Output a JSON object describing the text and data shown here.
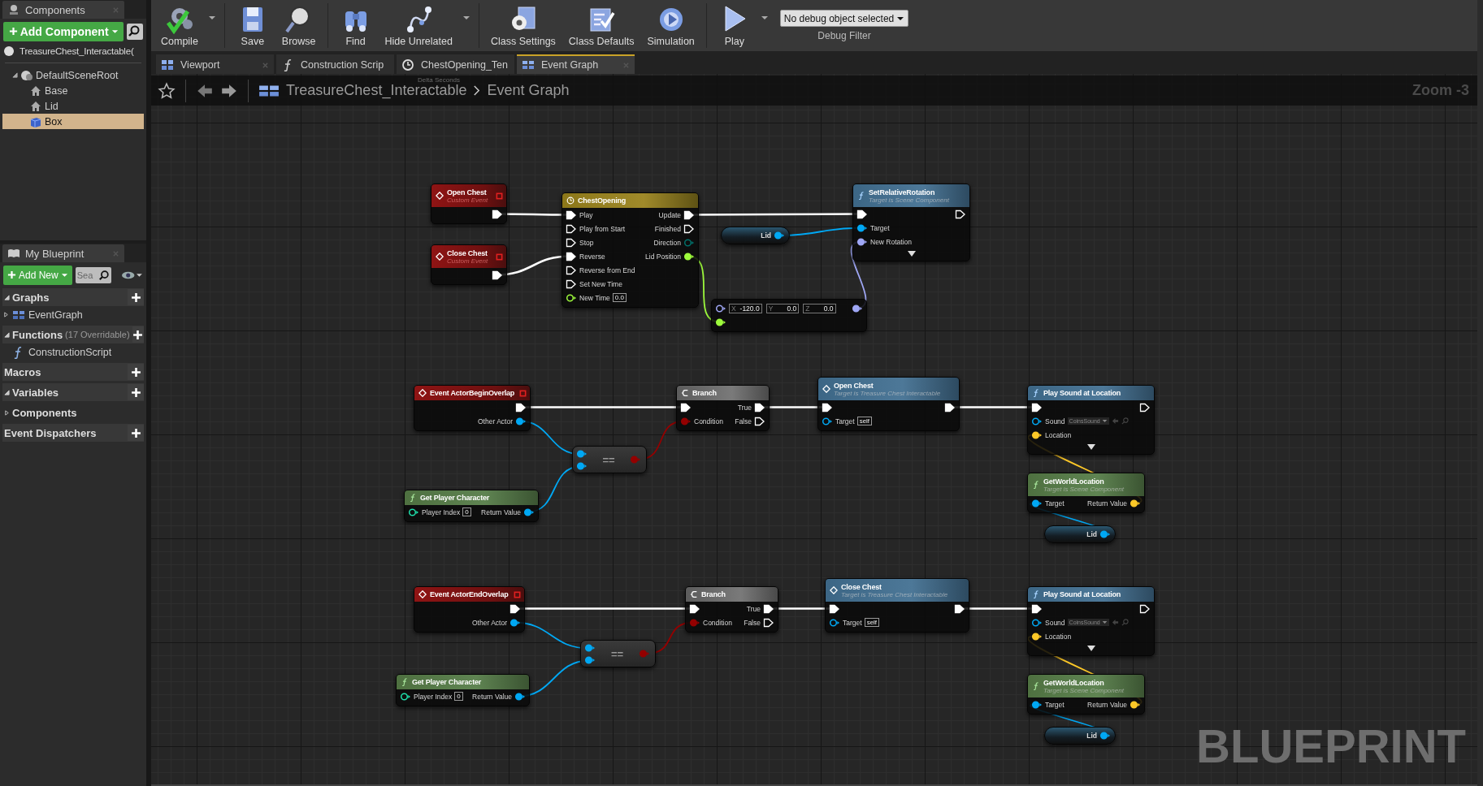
{
  "components": {
    "tab": "Components",
    "add_button": "Add Component",
    "self": "TreasureChest_Interactable(",
    "tree": [
      {
        "label": "DefaultSceneRoot",
        "kind": "scene_root",
        "expanded": true,
        "selected": false,
        "children": [
          {
            "label": "Base",
            "kind": "mesh",
            "selected": false
          },
          {
            "label": "Lid",
            "kind": "mesh",
            "selected": false
          },
          {
            "label": "Box",
            "kind": "box",
            "selected": true
          }
        ]
      }
    ]
  },
  "my_blueprint": {
    "tab": "My Blueprint",
    "add_button": "Add New",
    "search": {
      "placeholder": "Sea"
    },
    "sections": [
      {
        "label": "Graphs",
        "expanded": true,
        "addable": true,
        "items": [
          {
            "label": "EventGraph",
            "kind": "graph",
            "expanded": false
          }
        ]
      },
      {
        "label": "Functions",
        "note": "(17 Overridable)",
        "expanded": true,
        "addable": true,
        "items": [
          {
            "label": "ConstructionScript",
            "kind": "function"
          }
        ]
      },
      {
        "label": "Macros",
        "addable": true
      },
      {
        "label": "Variables",
        "expanded": true,
        "addable": true
      },
      {
        "label": "Components",
        "expanded": false,
        "addable": false
      },
      {
        "label": "Event Dispatchers",
        "addable": true
      }
    ]
  },
  "toolbar": {
    "groups": [
      [
        {
          "label": "Compile",
          "kind": "compile",
          "dropdown": true
        }
      ],
      [
        {
          "label": "Save",
          "kind": "save"
        },
        {
          "label": "Browse",
          "kind": "browse"
        }
      ],
      [
        {
          "label": "Find",
          "kind": "find"
        },
        {
          "label": "Hide Unrelated",
          "kind": "hide",
          "dropdown": true
        }
      ],
      [
        {
          "label": "Class Settings",
          "kind": "class_settings"
        },
        {
          "label": "Class Defaults",
          "kind": "class_defaults"
        },
        {
          "label": "Simulation",
          "kind": "simulation"
        }
      ],
      [
        {
          "label": "Play",
          "kind": "play",
          "dropdown": true
        }
      ]
    ],
    "debug": {
      "value": "No debug object selected",
      "label": "Debug Filter"
    }
  },
  "tabs": [
    {
      "label": "Viewport",
      "kind": "viewport",
      "selected": false
    },
    {
      "label": "Construction Scrip",
      "kind": "function",
      "selected": false
    },
    {
      "label": "ChestOpening_Ten",
      "kind": "timeline",
      "selected": false
    },
    {
      "label": "Event Graph",
      "kind": "graph",
      "selected": true
    }
  ],
  "breadcrumb": {
    "path": [
      "TreasureChest_Interactable",
      "Event Graph"
    ],
    "ghost_pin": "Delta Seconds"
  },
  "graph": {
    "zoom": "Zoom -3",
    "watermark": "BLUEPRINT",
    "nodes": [
      {
        "kind": "event",
        "title": "Open Chest",
        "subtitle": "Custom Event",
        "rows": [
          {
            "right": {
              "kind": "exec",
              "linked": true
            }
          }
        ]
      },
      {
        "kind": "event",
        "title": "Close Chest",
        "subtitle": "Custom Event",
        "rows": [
          {
            "right": {
              "kind": "exec",
              "linked": true
            }
          }
        ]
      },
      {
        "kind": "timeline",
        "title": "ChestOpening",
        "rows": [
          {
            "left": {
              "kind": "exec",
              "linked": true,
              "label": "Play"
            },
            "right": {
              "kind": "exec",
              "linked": true,
              "label": "Update"
            }
          },
          {
            "left": {
              "kind": "exec",
              "linked": false,
              "label": "Play from Start"
            },
            "right": {
              "kind": "exec",
              "linked": false,
              "label": "Finished"
            }
          },
          {
            "left": {
              "kind": "exec",
              "linked": false,
              "label": "Stop"
            },
            "right": {
              "kind": "byte",
              "linked": false,
              "label": "Direction"
            }
          },
          {
            "left": {
              "kind": "exec",
              "linked": true,
              "label": "Reverse"
            },
            "right": {
              "kind": "float",
              "linked": true,
              "label": "Lid Position"
            }
          },
          {
            "left": {
              "kind": "exec",
              "linked": false,
              "label": "Reverse from End"
            }
          },
          {
            "left": {
              "kind": "exec",
              "linked": false,
              "label": "Set New Time"
            }
          },
          {
            "left": {
              "kind": "float",
              "linked": false,
              "label": "New Time",
              "value": "0.0"
            }
          }
        ]
      },
      {
        "kind": "variable",
        "title": "Lid",
        "rows": [
          {
            "right": {
              "kind": "object",
              "linked": true
            }
          }
        ]
      },
      {
        "kind": "function",
        "title": "SetRelativeRotation",
        "subtitle": "Target is Scene Component",
        "more": true,
        "rows": [
          {
            "left": {
              "kind": "exec",
              "linked": true
            },
            "right": {
              "kind": "exec",
              "linked": false
            }
          },
          {
            "left": {
              "kind": "object",
              "linked": true,
              "label": "Target"
            }
          },
          {
            "left": {
              "kind": "rotator",
              "linked": true,
              "label": "New Rotation"
            }
          }
        ]
      },
      {
        "kind": "struct",
        "rows": [
          {
            "left": {
              "kind": "rotator",
              "linked": false,
              "fields": [
                {
                  "axis": "X",
                  "value": "-120.0"
                },
                {
                  "axis": "Y",
                  "value": "0.0"
                },
                {
                  "axis": "Z",
                  "value": "0.0"
                }
              ]
            },
            "right": {
              "kind": "rotator",
              "linked": true
            }
          },
          {
            "left": {
              "kind": "float",
              "linked": true
            }
          }
        ]
      },
      {
        "kind": "event",
        "title": "Event ActorBeginOverlap",
        "rows": [
          {
            "right": {
              "kind": "exec",
              "linked": true
            }
          },
          {
            "right": {
              "kind": "object",
              "linked": true,
              "label": "Other Actor"
            }
          }
        ]
      },
      {
        "kind": "compare",
        "title": "==",
        "rows": [
          {
            "left": {
              "kind": "object",
              "linked": true
            },
            "right": {
              "kind": "bool",
              "linked": true
            }
          },
          {
            "left": {
              "kind": "object",
              "linked": true
            }
          }
        ]
      },
      {
        "kind": "pure",
        "title": "Get Player Character",
        "rows": [
          {
            "left": {
              "kind": "int",
              "linked": false,
              "label": "Player Index",
              "value": "0"
            },
            "right": {
              "kind": "object",
              "linked": true,
              "label": "Return Value"
            }
          }
        ]
      },
      {
        "kind": "branch",
        "title": "Branch",
        "rows": [
          {
            "left": {
              "kind": "exec",
              "linked": true
            },
            "right": {
              "kind": "exec",
              "linked": true,
              "label": "True"
            }
          },
          {
            "left": {
              "kind": "bool",
              "linked": true,
              "label": "Condition"
            },
            "right": {
              "kind": "exec",
              "linked": false,
              "label": "False"
            }
          }
        ]
      },
      {
        "kind": "call",
        "title": "Open Chest",
        "subtitle": "Target is Treasure Chest Interactable",
        "rows": [
          {
            "left": {
              "kind": "exec",
              "linked": true
            },
            "right": {
              "kind": "exec",
              "linked": true
            }
          },
          {
            "left": {
              "kind": "object",
              "linked": false,
              "label": "Target",
              "value": "self"
            }
          }
        ]
      },
      {
        "kind": "function",
        "title": "Play Sound at Location",
        "more": true,
        "rows": [
          {
            "left": {
              "kind": "exec",
              "linked": true
            },
            "right": {
              "kind": "exec",
              "linked": false
            }
          },
          {
            "left": {
              "kind": "object",
              "linked": false,
              "label": "Sound",
              "asset": "CoinsSound"
            }
          },
          {
            "left": {
              "kind": "vector",
              "linked": true,
              "label": "Location"
            }
          }
        ]
      },
      {
        "kind": "pure",
        "title": "GetWorldLocation",
        "subtitle": "Target is Scene Component",
        "rows": [
          {
            "left": {
              "kind": "object",
              "linked": true,
              "label": "Target"
            },
            "right": {
              "kind": "vector",
              "linked": true,
              "label": "Return Value"
            }
          }
        ]
      },
      {
        "kind": "variable",
        "title": "Lid",
        "rows": [
          {
            "right": {
              "kind": "object",
              "linked": true
            }
          }
        ]
      },
      {
        "kind": "event",
        "title": "Event ActorEndOverlap",
        "rows": [
          {
            "right": {
              "kind": "exec",
              "linked": true
            }
          },
          {
            "right": {
              "kind": "object",
              "linked": true,
              "label": "Other Actor"
            }
          }
        ]
      },
      {
        "kind": "compare",
        "title": "==",
        "rows": [
          {
            "left": {
              "kind": "object",
              "linked": true
            },
            "right": {
              "kind": "bool",
              "linked": true
            }
          },
          {
            "left": {
              "kind": "object",
              "linked": true
            }
          }
        ]
      },
      {
        "kind": "pure",
        "title": "Get Player Character",
        "rows": [
          {
            "left": {
              "kind": "int",
              "linked": false,
              "label": "Player Index",
              "value": "0"
            },
            "right": {
              "kind": "object",
              "linked": true,
              "label": "Return Value"
            }
          }
        ]
      },
      {
        "kind": "branch",
        "title": "Branch",
        "rows": [
          {
            "left": {
              "kind": "exec",
              "linked": true
            },
            "right": {
              "kind": "exec",
              "linked": true,
              "label": "True"
            }
          },
          {
            "left": {
              "kind": "bool",
              "linked": true,
              "label": "Condition"
            },
            "right": {
              "kind": "exec",
              "linked": false,
              "label": "False"
            }
          }
        ]
      },
      {
        "kind": "call",
        "title": "Close Chest",
        "subtitle": "Target is Treasure Chest Interactable",
        "rows": [
          {
            "left": {
              "kind": "exec",
              "linked": true
            },
            "right": {
              "kind": "exec",
              "linked": true
            }
          },
          {
            "left": {
              "kind": "object",
              "linked": false,
              "label": "Target",
              "value": "self"
            }
          }
        ]
      },
      {
        "kind": "function",
        "title": "Play Sound at Location",
        "more": true,
        "rows": [
          {
            "left": {
              "kind": "exec",
              "linked": true
            },
            "right": {
              "kind": "exec",
              "linked": false
            }
          },
          {
            "left": {
              "kind": "object",
              "linked": false,
              "label": "Sound",
              "asset": "CoinsSound"
            }
          },
          {
            "left": {
              "kind": "vector",
              "linked": true,
              "label": "Location"
            }
          }
        ]
      },
      {
        "kind": "pure",
        "title": "GetWorldLocation",
        "subtitle": "Target is Scene Component",
        "rows": [
          {
            "left": {
              "kind": "object",
              "linked": true,
              "label": "Target"
            },
            "right": {
              "kind": "vector",
              "linked": true,
              "label": "Return Value"
            }
          }
        ]
      },
      {
        "kind": "variable",
        "title": "Lid",
        "rows": [
          {
            "right": {
              "kind": "object",
              "linked": true
            }
          }
        ]
      }
    ]
  }
}
